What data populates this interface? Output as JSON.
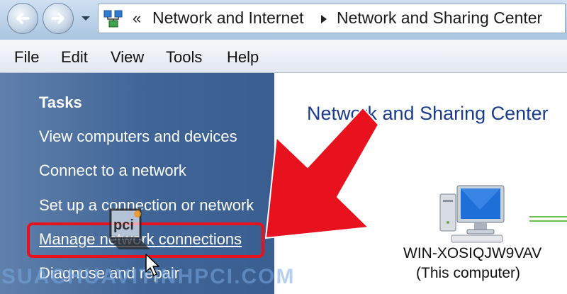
{
  "address_bar": {
    "overflow": "«",
    "breadcrumbs": [
      "Network and Internet",
      "Network and Sharing Center"
    ]
  },
  "menu": {
    "items": [
      "File",
      "Edit",
      "View",
      "Tools",
      "Help"
    ]
  },
  "tasks": {
    "heading": "Tasks",
    "items": [
      "View computers and devices",
      "Connect to a network",
      "Set up a connection or network",
      "Manage network connections",
      "Diagnose and repair"
    ]
  },
  "content": {
    "title": "Network and Sharing Center",
    "computer_name": "WIN-XOSIQJW9VAV",
    "computer_subtitle": "(This computer)"
  },
  "watermark": {
    "text": "SUACHUAVITINHPCI.COM",
    "logo_text": "pci"
  },
  "colors": {
    "task_pane": "#3f6496",
    "title_blue": "#1a3c8f",
    "highlight_red": "#e8121e",
    "link_green": "#6cc24a"
  },
  "icons": [
    "back-arrow-icon",
    "forward-arrow-icon",
    "chevron-down-icon",
    "network-folder-icon",
    "breadcrumb-arrow-icon",
    "computer-icon",
    "mouse-cursor-icon"
  ]
}
